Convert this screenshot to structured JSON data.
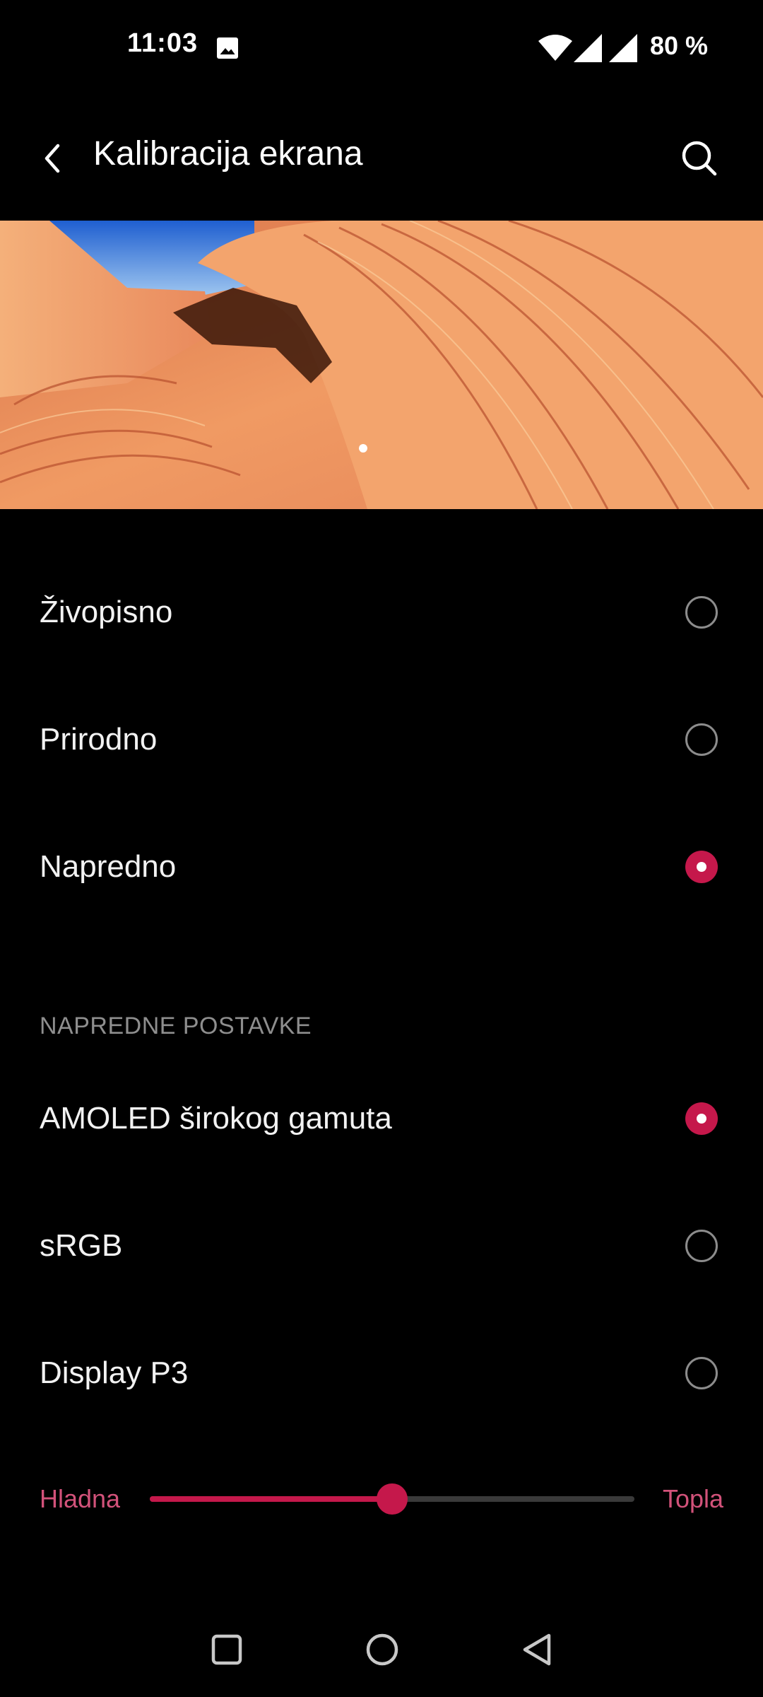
{
  "status_bar": {
    "time": "11:03",
    "battery": "80 %",
    "icons": [
      "image-icon",
      "wifi-icon",
      "signal-icon",
      "signal-icon"
    ]
  },
  "app_bar": {
    "title": "Kalibracija ekrana",
    "back_icon": "back-arrow-icon",
    "search_icon": "search-icon"
  },
  "preview": {
    "description_icon": "landscape-preview",
    "page_indicator_count": 1
  },
  "modes": [
    {
      "label": "Živopisno",
      "selected": false
    },
    {
      "label": "Prirodno",
      "selected": false
    },
    {
      "label": "Napredno",
      "selected": true
    }
  ],
  "advanced": {
    "header": "NAPREDNE POSTAVKE",
    "options": [
      {
        "label": "AMOLED širokog gamuta",
        "selected": true
      },
      {
        "label": "sRGB",
        "selected": false
      },
      {
        "label": "Display P3",
        "selected": false
      }
    ]
  },
  "temperature": {
    "min_label": "Hladna",
    "max_label": "Topla",
    "value": 0.5
  },
  "colors": {
    "accent": "#c5184b",
    "slider_label": "#d2527a",
    "background": "#000000",
    "section_header": "#8e8e8e"
  },
  "nav_bar": {
    "icons": [
      "recents-square-icon",
      "home-circle-icon",
      "back-triangle-icon"
    ]
  }
}
